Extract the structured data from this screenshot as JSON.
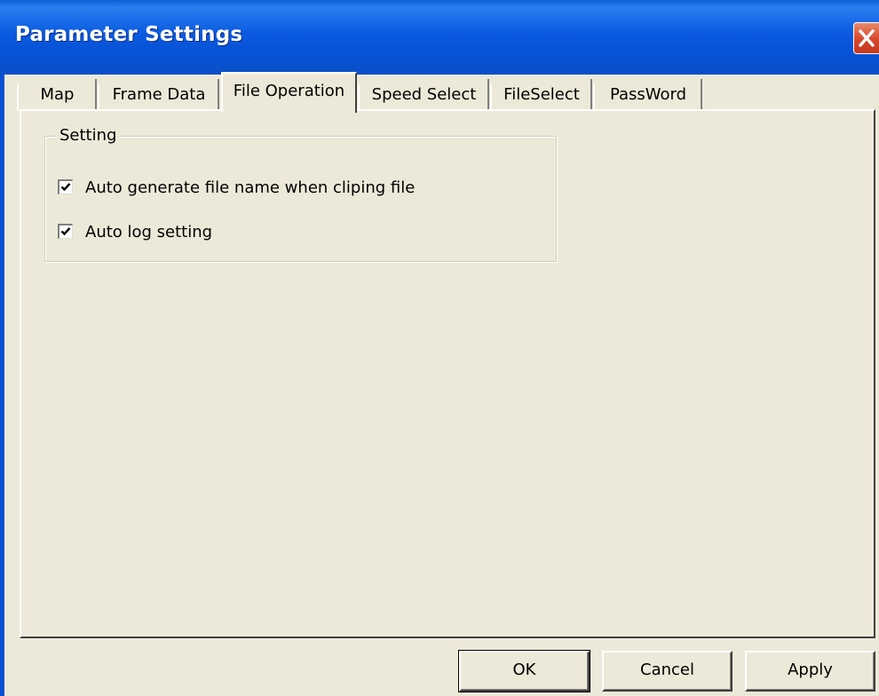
{
  "window": {
    "title": "Parameter Settings",
    "close_icon": "close-icon",
    "colors": {
      "titlebar": "#0a56d8",
      "close": "#d6462a",
      "face": "#ece9d8"
    }
  },
  "tabs": [
    {
      "label": "Map",
      "active": false
    },
    {
      "label": "Frame Data",
      "active": false
    },
    {
      "label": "File Operation",
      "active": true
    },
    {
      "label": "Speed Select",
      "active": false
    },
    {
      "label": "FileSelect",
      "active": false
    },
    {
      "label": "PassWord",
      "active": false
    }
  ],
  "panel": {
    "group_title": "Setting",
    "options": [
      {
        "label": "Auto generate file name when cliping file",
        "checked": true
      },
      {
        "label": "Auto log setting",
        "checked": true
      }
    ]
  },
  "buttons": {
    "ok": "OK",
    "cancel": "Cancel",
    "apply": "Apply"
  }
}
